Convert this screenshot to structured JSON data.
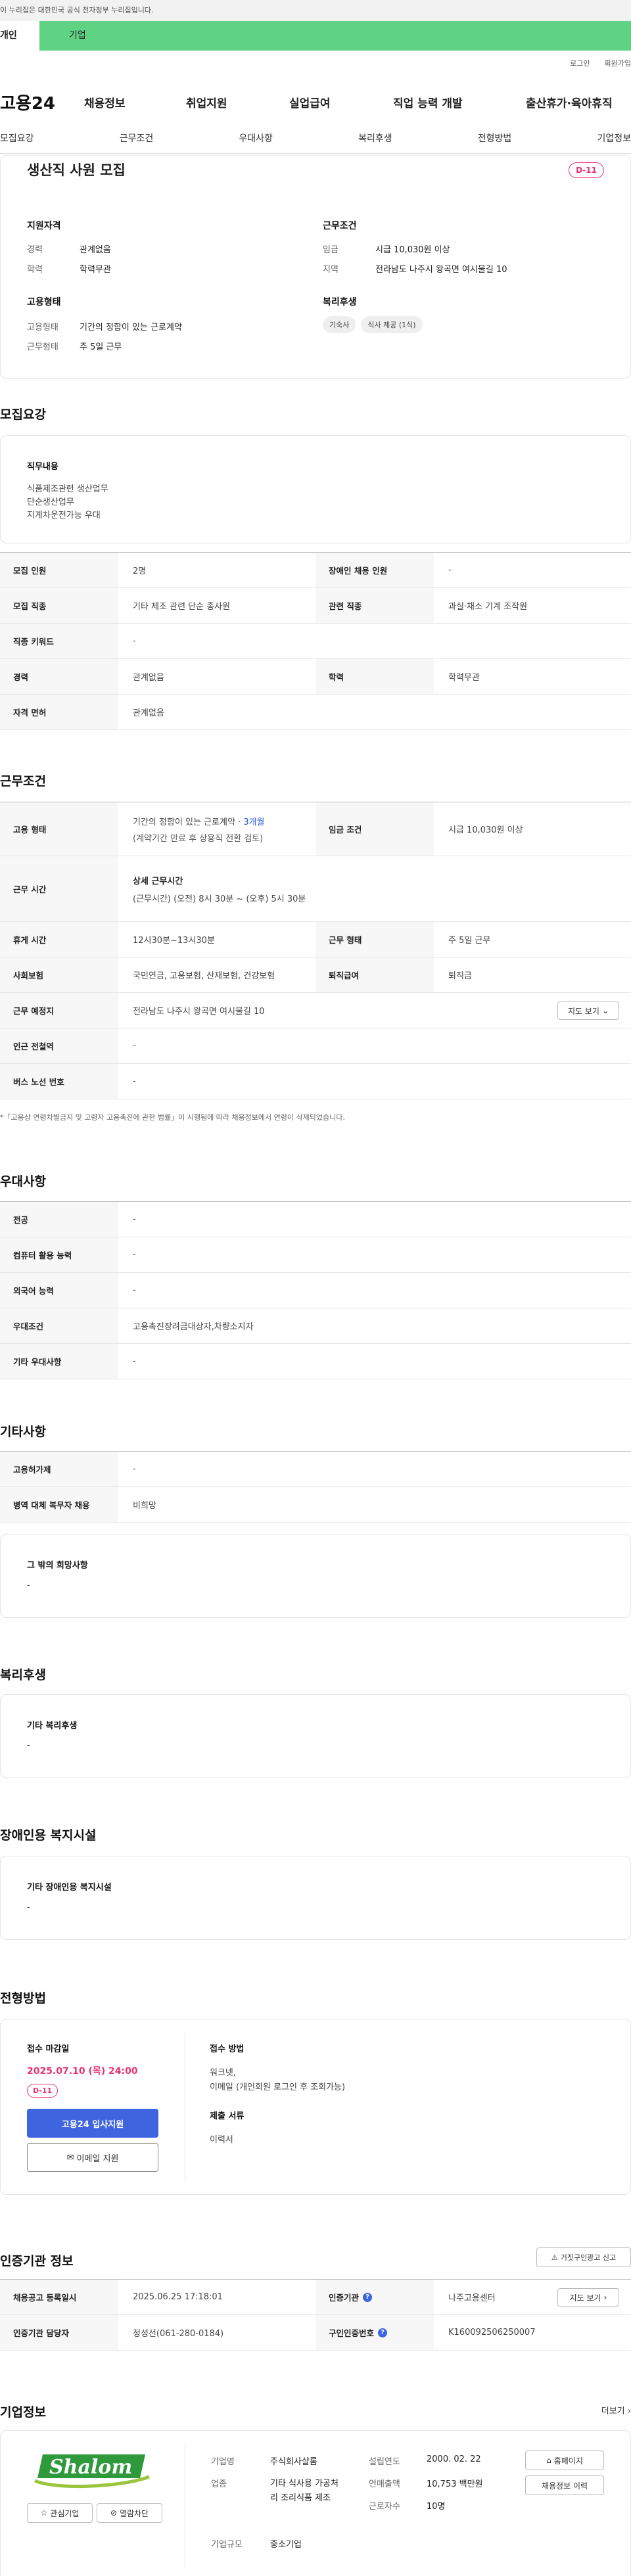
{
  "gov_banner": "이 누리집은 대한민국 공식 전자정부 누리집입니다.",
  "user_tabs": {
    "individual": "개인",
    "company": "기업"
  },
  "top_links": {
    "login": "로그인",
    "join": "회원가입"
  },
  "gnb": {
    "logo": "고용24",
    "items": [
      "채용정보",
      "취업지원",
      "실업급여",
      "직업 능력 개발",
      "출산휴가·육아휴직"
    ]
  },
  "section_nav": [
    "모집요강",
    "근무조건",
    "우대사항",
    "복리후생",
    "전형방법",
    "기업정보"
  ],
  "summary": {
    "title": "생산직 사원 모집",
    "dday": "D-11",
    "qual_title": "지원자격",
    "career_label": "경력",
    "career": "관계없음",
    "edu_label": "학력",
    "edu": "학력무관",
    "emp_title": "고용형태",
    "emp_type_label": "고용형태",
    "emp_type": "기간의 정함이 있는 근로계약",
    "work_days_label": "근무형태",
    "work_days": "주 5일 근무",
    "cond_title": "근무조건",
    "wage_label": "임금",
    "wage": "시급 10,030원 이상",
    "region_label": "지역",
    "region": "전라남도 나주시 왕곡면 여시물길 10",
    "welfare_title": "복리후생",
    "chips": [
      "기숙사",
      "식사 제공 (1식)"
    ]
  },
  "recruit": {
    "heading": "모집요강",
    "duty_title": "직무내용",
    "duty_lines": [
      "식품제조관련 생산업무",
      "단순생산업무",
      "지게차운전가능 우대"
    ],
    "rows": [
      {
        "k1": "모집 인원",
        "v1": "2명",
        "k2": "장애인 채용 인원",
        "v2": "-"
      },
      {
        "k1": "모집 직종",
        "v1": "기타 제조 관련 단순 종사원",
        "k2": "관련 직종",
        "v2": "과실·채소 기계 조작원"
      },
      {
        "k1": "직종 키워드",
        "v1": "-"
      },
      {
        "k1": "경력",
        "v1": "관계없음",
        "k2": "학력",
        "v2": "학력무관"
      },
      {
        "k1": "자격 면허",
        "v1": "관계없음"
      }
    ]
  },
  "work": {
    "heading": "근무조건",
    "emp_label": "고용 형태",
    "emp_line1": "기간의 정함이 있는 근로계약 · ",
    "emp_months": "3개월",
    "emp_line2": "(계약기간 만료 후 상용직 전환 검토)",
    "wage_label": "임금 조건",
    "wage": "시급 10,030원 이상",
    "time_label": "근무 시간",
    "time_title": "상세 근무시간",
    "time_detail": "(근무시간) (오전) 8시 30분 ~ (오후) 5시 30분",
    "rest_label": "휴게 시간",
    "rest": "12시30분~13시30분",
    "type_label": "근무 형태",
    "type": "주 5일 근무",
    "ins_label": "사회보험",
    "ins": "국민연금, 고용보험, 산재보험, 건강보험",
    "sev_label": "퇴직급여",
    "sev": "퇴직금",
    "loc_label": "근무 예정지",
    "loc": "전라남도 나주시 왕곡면 여시물길 10",
    "map_btn": "지도 보기",
    "subway_label": "인근 전철역",
    "subway": "-",
    "bus_label": "버스 노선 번호",
    "bus": "-",
    "note": "*「고용상 연령차별금지 및 고령자 고용촉진에 관한 법률」이 시행됨에 따라 채용정보에서 연령이 삭제되었습니다."
  },
  "pref": {
    "heading": "우대사항",
    "rows": [
      {
        "k": "전공",
        "v": "-"
      },
      {
        "k": "컴퓨터 활용 능력",
        "v": "-"
      },
      {
        "k": "외국어 능력",
        "v": "-"
      },
      {
        "k": "우대조건",
        "v": "고용촉진장려금대상자,차량소지자"
      },
      {
        "k": "기타 우대사항",
        "v": "-"
      }
    ]
  },
  "etc": {
    "heading": "기타사항",
    "rows": [
      {
        "k": "고용허가제",
        "v": "-"
      },
      {
        "k": "병역 대체 복무자 채용",
        "v": "비희망"
      }
    ],
    "box_title": "그 밖의 희망사항",
    "box_val": "-"
  },
  "welfare": {
    "heading": "복리후생",
    "box_title": "기타 복리후생",
    "box_val": "-"
  },
  "disab": {
    "heading": "장애인용 복지시설",
    "box_title": "기타 장애인용 복지시설",
    "box_val": "-"
  },
  "process": {
    "heading": "전형방법",
    "deadline_title": "접수 마감일",
    "deadline": "2025.07.10 (목) 24:00",
    "dday": "D-11",
    "apply_btn": "고용24 입사지원",
    "email_btn": "이메일 지원",
    "method_title": "접수 방법",
    "method_lines": [
      "워크넷,",
      "이메일 (개인회원 로그인 후 조회가능)"
    ],
    "docs_title": "제출 서류",
    "docs": "이력서"
  },
  "agency": {
    "heading": "인증기관 정보",
    "report_btn": "거짓구인광고 신고",
    "reg_label": "채용공고 등록일시",
    "reg": "2025.06.25 17:18:01",
    "cert_label": "인증기관",
    "cert": "나주고용센터",
    "map_btn": "지도 보기",
    "mgr_label": "인증기관 담당자",
    "mgr": "정성선(061-280-0184)",
    "id_label": "구인인증번호",
    "id": "K160092506250007"
  },
  "company": {
    "heading": "기업정보",
    "more": "더보기",
    "logo_text": "Shalom",
    "fav_btn": "관심기업",
    "block_btn": "열람차단",
    "name_label": "기업명",
    "name": "주식회사샬롬",
    "ind_label": "업종",
    "ind": "기타 식사용 가공처리 조리식품 제조",
    "size_label": "기업규모",
    "size": "중소기업",
    "est_label": "설립연도",
    "est": "2000. 02. 22",
    "sales_label": "연매출액",
    "sales": "10,753 백만원",
    "emp_label": "근로자수",
    "emp": "10명",
    "home_btn": "홈페이지",
    "hist_btn": "채용정보 이력"
  }
}
